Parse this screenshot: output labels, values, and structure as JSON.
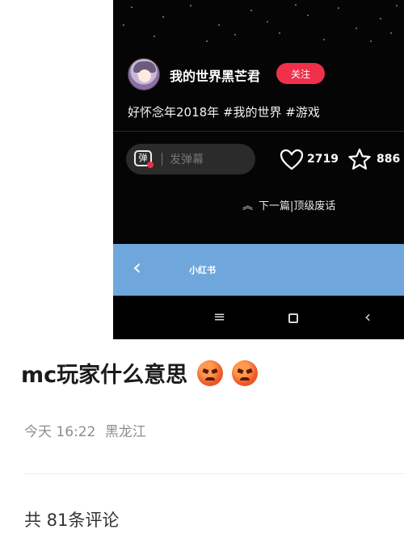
{
  "author": {
    "name": "我的世界黑芒君",
    "follow_label": "关注"
  },
  "post_text": "好怀念年2018年 #我的世界 #游戏",
  "danmaku": {
    "icon_char": "弹",
    "placeholder": "发弹幕"
  },
  "stats": {
    "likes": "2719",
    "favorites": "886"
  },
  "next": {
    "label": "下一篇|顶级废话"
  },
  "xhs": {
    "logo": "小红书"
  },
  "post": {
    "title": "mc玩家什么意思",
    "time": "今天 16:22",
    "location": "黑龙江",
    "comments": "共 81条评论"
  },
  "icons": {
    "like": "heart-icon",
    "favorite": "star-icon",
    "next": "double-chevron-up-icon",
    "back": "chevron-left-icon",
    "menu": "menu-icon",
    "home": "square-icon",
    "nav_back": "chevron-left-icon",
    "emoji": "angry-face-emoji"
  },
  "colors": {
    "accent": "#f0304b",
    "bar_blue": "#6fa7dc",
    "dark_bg": "#050505"
  }
}
